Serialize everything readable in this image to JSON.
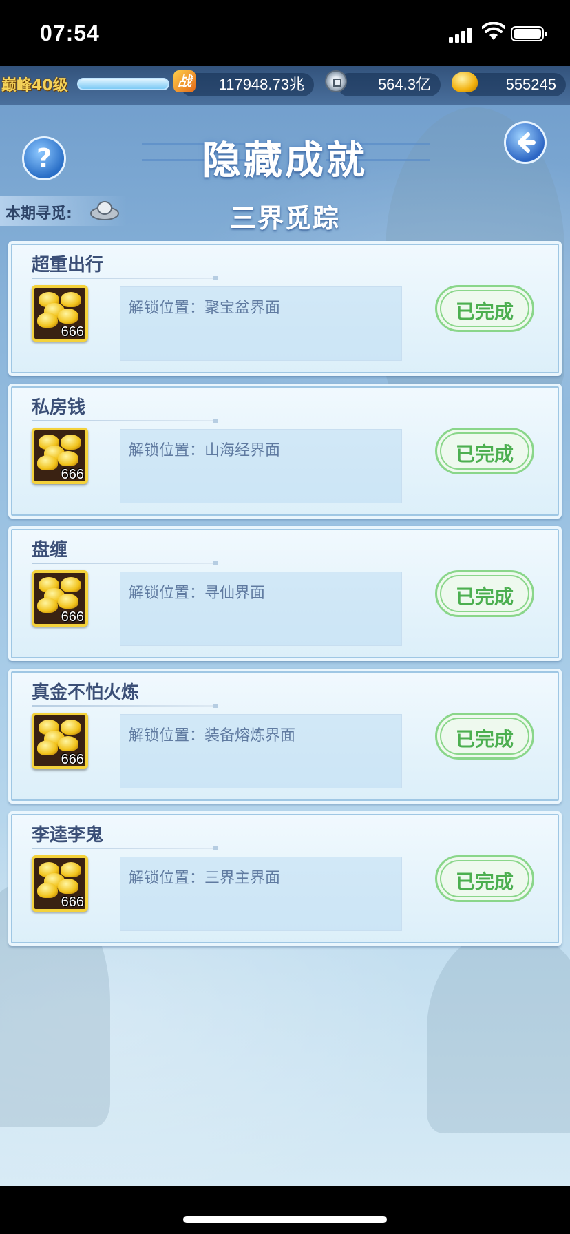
{
  "status_bar": {
    "time": "07:54"
  },
  "resources": {
    "level": "巅峰40级",
    "power_icon_text": "战",
    "power": "117948.73兆",
    "silver": "564.3亿",
    "gold": "555245"
  },
  "header": {
    "help_label": "?",
    "title": "隐藏成就",
    "period_label": "本期寻觅:",
    "subtitle": "三界觅踪"
  },
  "achievements": [
    {
      "name": "超重出行",
      "location": "解锁位置：聚宝盆界面",
      "reward_count": "666",
      "status": "已完成"
    },
    {
      "name": "私房钱",
      "location": "解锁位置：山海经界面",
      "reward_count": "666",
      "status": "已完成"
    },
    {
      "name": "盘缠",
      "location": "解锁位置：寻仙界面",
      "reward_count": "666",
      "status": "已完成"
    },
    {
      "name": "真金不怕火炼",
      "location": "解锁位置：装备熔炼界面",
      "reward_count": "666",
      "status": "已完成"
    },
    {
      "name": "李逵李鬼",
      "location": "解锁位置：三界主界面",
      "reward_count": "666",
      "status": "已完成"
    }
  ],
  "colors": {
    "title_text": "#ffffff",
    "card_title": "#3b4f77",
    "done_green": "#4caf50",
    "reward_border": "#f4d23b"
  }
}
